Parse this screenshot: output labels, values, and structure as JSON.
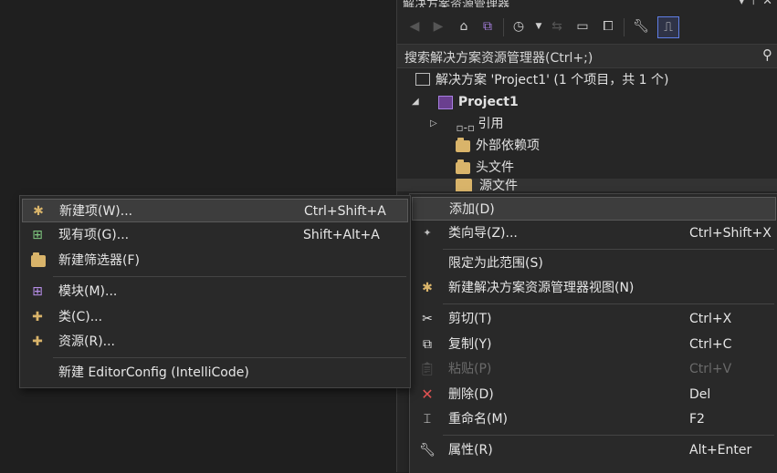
{
  "solution_explorer": {
    "title": "解决方案资源管理器",
    "title_actions": "▾ ⊤ ✕",
    "search_placeholder": "搜索解决方案资源管理器(Ctrl+;)",
    "tree": {
      "solution": "解决方案 'Project1' (1 个项目，共 1 个)",
      "project": "Project1",
      "references": "引用",
      "external_deps": "外部依赖项",
      "headers": "头文件",
      "sources": "源文件"
    }
  },
  "context_menu": {
    "items": [
      {
        "label": "添加(D)",
        "shortcut": ""
      },
      {
        "label": "类向导(Z)...",
        "shortcut": "Ctrl+Shift+X"
      },
      {
        "label": "限定为此范围(S)",
        "shortcut": ""
      },
      {
        "label": "新建解决方案资源管理器视图(N)",
        "shortcut": ""
      },
      {
        "label": "剪切(T)",
        "shortcut": "Ctrl+X"
      },
      {
        "label": "复制(Y)",
        "shortcut": "Ctrl+C"
      },
      {
        "label": "粘贴(P)",
        "shortcut": "Ctrl+V"
      },
      {
        "label": "删除(D)",
        "shortcut": "Del"
      },
      {
        "label": "重命名(M)",
        "shortcut": "F2"
      },
      {
        "label": "属性(R)",
        "shortcut": "Alt+Enter"
      }
    ]
  },
  "add_submenu": {
    "items": [
      {
        "label": "新建项(W)...",
        "shortcut": "Ctrl+Shift+A"
      },
      {
        "label": "现有项(G)...",
        "shortcut": "Shift+Alt+A"
      },
      {
        "label": "新建筛选器(F)",
        "shortcut": ""
      },
      {
        "label": "模块(M)...",
        "shortcut": ""
      },
      {
        "label": "类(C)...",
        "shortcut": ""
      },
      {
        "label": "资源(R)...",
        "shortcut": ""
      },
      {
        "label": "新建 EditorConfig (IntelliCode)",
        "shortcut": ""
      }
    ]
  }
}
